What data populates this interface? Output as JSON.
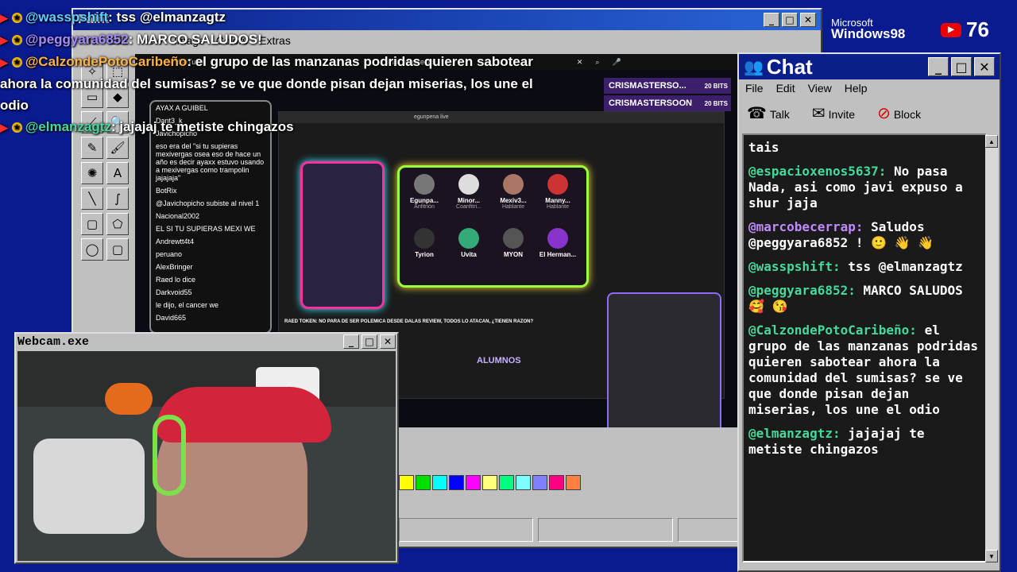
{
  "overlay_chat": [
    {
      "user": "@wasspshift",
      "text": ": tss @elmanzagtz"
    },
    {
      "user": "@peggyara6852",
      "text": ": MARCO SALUDOS!"
    },
    {
      "user": "@CalzondePotoCaribeño",
      "text": ": el grupo de las manzanas podridas quieren sabotear ahora la comunidad del sumisas? se ve que donde pisan dejan miserias, los une el odio"
    },
    {
      "user": "@elmanzagtz",
      "text": ": jajajaj te metiste chingazos"
    }
  ],
  "branding": {
    "microsoft": "Microsoft",
    "windows": "Windows98"
  },
  "viewers": {
    "count": "76"
  },
  "paint": {
    "title": "Paint",
    "menu": [
      "File",
      "Edit",
      "View",
      "Image",
      "Colors",
      "Extras"
    ]
  },
  "stream": {
    "tab_title": "YouTube",
    "search": "shur en directo",
    "browser_search": "egunpena live",
    "bits": [
      {
        "name": "CRISMASTERSO...",
        "amount": "20 BITS"
      },
      {
        "name": "CRISMASTERSOON",
        "amount": "20 BITS"
      }
    ],
    "guests": [
      {
        "name": "Egunpa...",
        "role": "Anfitrión"
      },
      {
        "name": "Minor...",
        "role": "Coanfitri..."
      },
      {
        "name": "Mexiv3...",
        "role": "Hablante"
      },
      {
        "name": "Manny...",
        "role": "Hablante"
      },
      {
        "name": "Tyrion",
        "role": ""
      },
      {
        "name": "Uvita",
        "role": ""
      },
      {
        "name": "MYON",
        "role": ""
      },
      {
        "name": "El Herman...",
        "role": ""
      }
    ],
    "side_chat": [
      "AYAX A GUIBEL",
      "Dant3_k",
      "Javichopicho",
      "eso era del \"si tu supieras mexivergas osea eso de hace un año es decir ayaxx estuvo usando a mexivergas como trampolin jajajaja\"",
      "BotRix",
      "@Javichopicho subiste al nivel 1",
      "Nacional2002",
      "EL SI TU SUPIERAS MEXI WE",
      "Andrewtt4t4",
      "peruano",
      "AlexBringer",
      "Raed lo dice",
      "Darkvoid55",
      "le dijo, el cancer we",
      "David665"
    ],
    "caption": "RAED TOKEN: NO PARA DE SER POLEMICA DESDE DALAS REVIEW, TODOS LO ATACAN, ¿TIENEN RAZON?",
    "alumnos": "ALUMNOS"
  },
  "palette": [
    "#ffff00",
    "#00e000",
    "#00ffff",
    "#0000ff",
    "#ff00ff",
    "#ffff80",
    "#00ff80",
    "#80ffff",
    "#8080ff",
    "#ff0080",
    "#ff8040"
  ],
  "webcam": {
    "title": "Webcam.exe"
  },
  "chat": {
    "title": "Chat",
    "menu": [
      "File",
      "Edit",
      "View",
      "Help"
    ],
    "toolbar": [
      "Talk",
      "Invite",
      "Block"
    ],
    "messages": [
      {
        "user": "",
        "text": "tais"
      },
      {
        "user": "@espacioxenos5637:",
        "text": "No pasa Nada, asi como javi expuso a shur jaja"
      },
      {
        "user": "@marcobecerrap:",
        "text": "Saludos @peggyara6852 ! 🙂 👋 👋"
      },
      {
        "user": "@wasspshift:",
        "text": "tss @elmanzagtz"
      },
      {
        "user": "@peggyara6852:",
        "text": "MARCO SALUDOS 🥰 😘"
      },
      {
        "user": "@CalzondePotoCaribeño:",
        "text": "el grupo de las manzanas podridas quieren sabotear ahora la comunidad del sumisas? se ve que donde pisan dejan miserias, los une el odio"
      },
      {
        "user": "@elmanzagtz:",
        "text": "jajajaj te metiste chingazos"
      }
    ]
  }
}
